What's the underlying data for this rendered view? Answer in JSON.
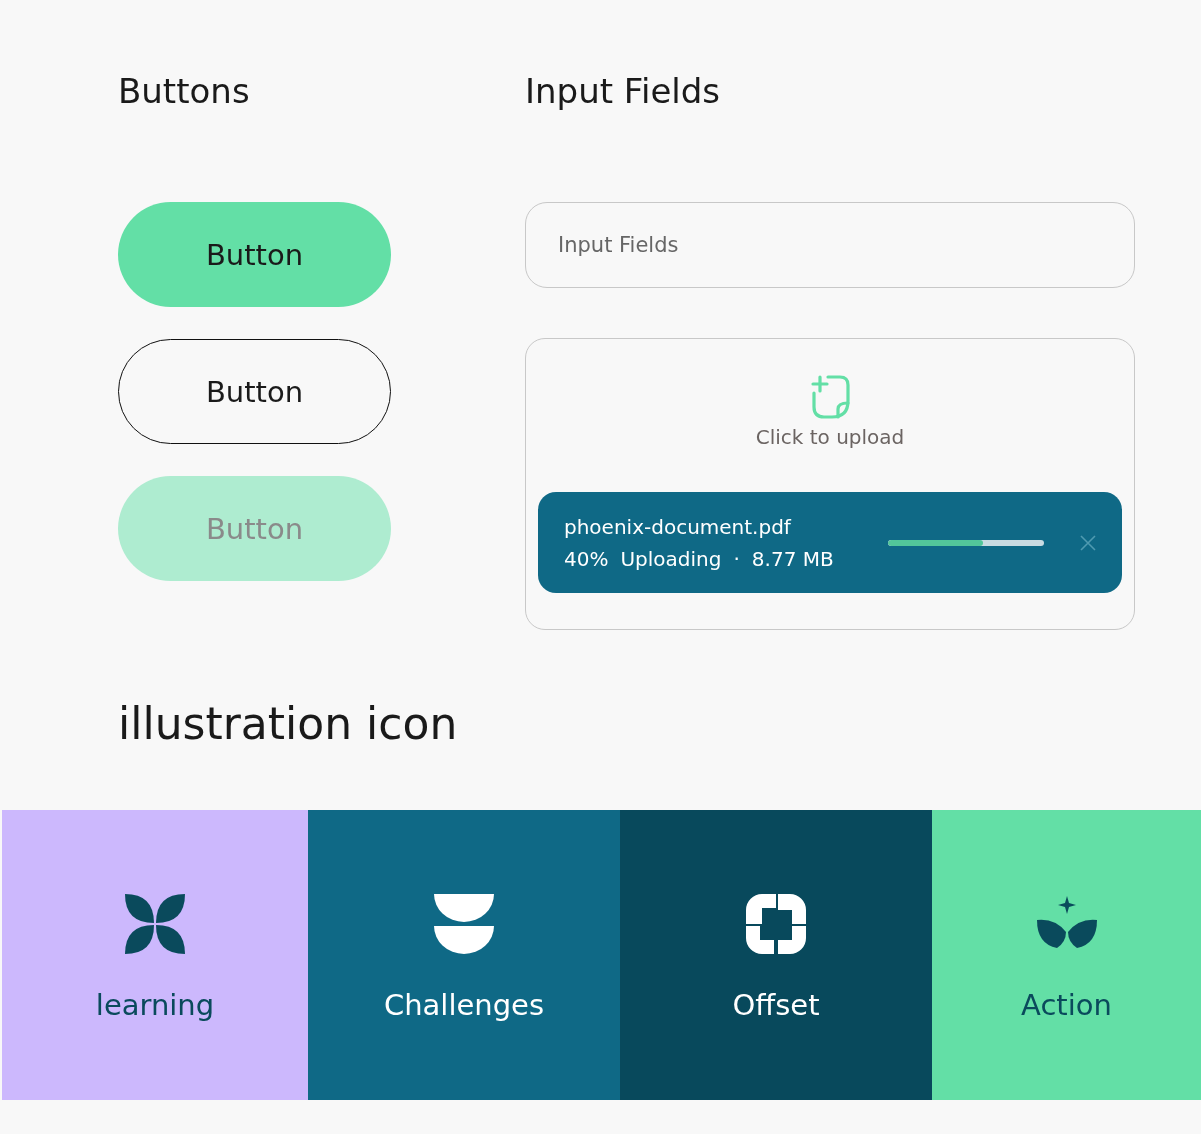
{
  "buttons_section": {
    "title": "Buttons",
    "buttons": [
      {
        "label": "Button",
        "kind": "primary"
      },
      {
        "label": "Button",
        "kind": "outline"
      },
      {
        "label": "Button",
        "kind": "disabled"
      }
    ]
  },
  "inputs_section": {
    "title": "Input Fields",
    "input": {
      "placeholder": "Input Fields"
    },
    "upload": {
      "prompt": "Click to upload",
      "file": {
        "name": "phoenix-document.pdf",
        "percent": "40%",
        "status": "Uploading",
        "separator": "·",
        "size": "8.77 MB",
        "level": 0.61
      }
    }
  },
  "illustration_section": {
    "title": "illustration icon",
    "tiles": [
      {
        "label": "learning",
        "kind": "petals",
        "color": "#ccb8fd"
      },
      {
        "label": "Challenges",
        "kind": "bowls",
        "color": "#0f6986"
      },
      {
        "label": "Offset",
        "kind": "pinwheel",
        "color": "#08495c"
      },
      {
        "label": "Action",
        "kind": "sprout",
        "color": "#63dfa6"
      }
    ]
  }
}
